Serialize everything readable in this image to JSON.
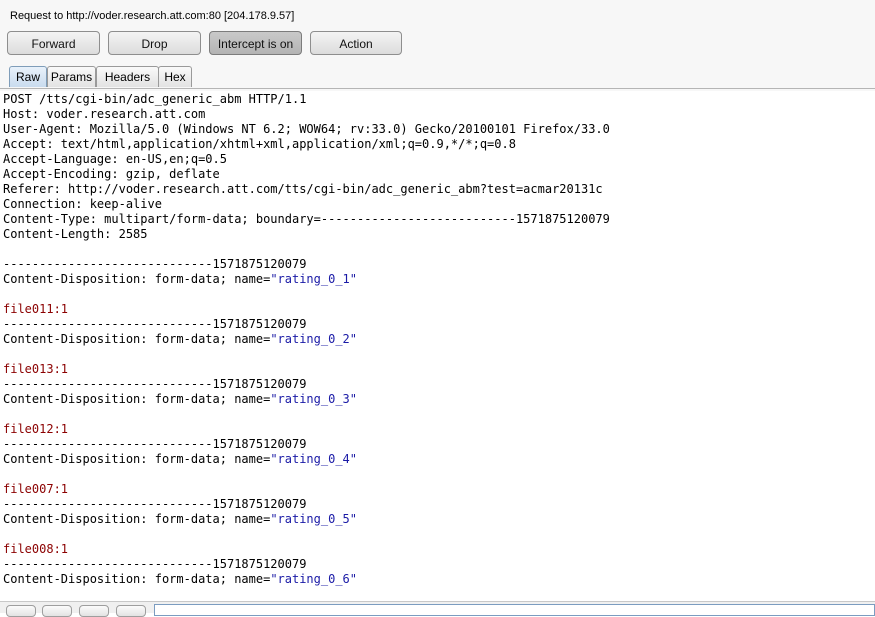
{
  "header": {
    "request_text": "Request to http://voder.research.att.com:80  [204.178.9.57]"
  },
  "buttons": [
    "Forward",
    "Drop",
    "Intercept is on",
    "Action"
  ],
  "tabs": [
    "Raw",
    "Params",
    "Headers",
    "Hex"
  ],
  "active_tab": "Raw",
  "lines": [
    {
      "text": "POST /tts/cgi-bin/adc_generic_abm HTTP/1.1"
    },
    {
      "text": "Host: voder.research.att.com"
    },
    {
      "text": "User-Agent: Mozilla/5.0 (Windows NT 6.2; WOW64; rv:33.0) Gecko/20100101 Firefox/33.0"
    },
    {
      "text": "Accept: text/html,application/xhtml+xml,application/xml;q=0.9,*/*;q=0.8"
    },
    {
      "text": "Accept-Language: en-US,en;q=0.5"
    },
    {
      "text": "Accept-Encoding: gzip, deflate"
    },
    {
      "text": "Referer: http://voder.research.att.com/tts/cgi-bin/adc_generic_abm?test=acmar20131c"
    },
    {
      "text": "Connection: keep-alive"
    },
    {
      "text": "Content-Type: multipart/form-data; boundary=---------------------------1571875120079"
    },
    {
      "text": "Content-Length: 2585"
    },
    {
      "text": ""
    },
    {
      "text": "-----------------------------1571875120079"
    },
    {
      "prefix": "Content-Disposition: form-data; name=",
      "value": "\"rating_0_1\""
    },
    {
      "text": ""
    },
    {
      "kw": "file011:1"
    },
    {
      "text": "-----------------------------1571875120079"
    },
    {
      "prefix": "Content-Disposition: form-data; name=",
      "value": "\"rating_0_2\""
    },
    {
      "text": ""
    },
    {
      "kw": "file013:1"
    },
    {
      "text": "-----------------------------1571875120079"
    },
    {
      "prefix": "Content-Disposition: form-data; name=",
      "value": "\"rating_0_3\""
    },
    {
      "text": ""
    },
    {
      "kw": "file012:1"
    },
    {
      "text": "-----------------------------1571875120079"
    },
    {
      "prefix": "Content-Disposition: form-data; name=",
      "value": "\"rating_0_4\""
    },
    {
      "text": ""
    },
    {
      "kw": "file007:1"
    },
    {
      "text": "-----------------------------1571875120079"
    },
    {
      "prefix": "Content-Disposition: form-data; name=",
      "value": "\"rating_0_5\""
    },
    {
      "text": ""
    },
    {
      "kw": "file008:1"
    },
    {
      "text": "-----------------------------1571875120079"
    },
    {
      "prefix": "Content-Disposition: form-data; name=",
      "value": "\"rating_0_6\""
    }
  ]
}
